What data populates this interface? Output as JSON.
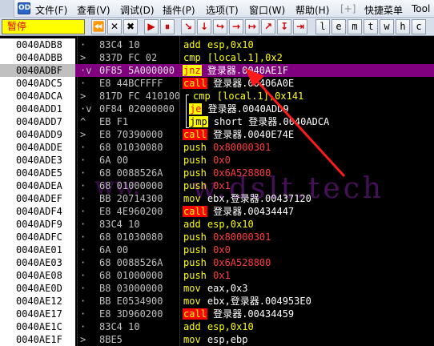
{
  "menu": {
    "items": [
      "文件(F)",
      "查看(V)",
      "调试(D)",
      "插件(P)",
      "选项(T)",
      "窗口(W)",
      "帮助(H)",
      "[+]",
      "快捷菜单",
      "Tool"
    ]
  },
  "toolbar": {
    "status": "暂停",
    "buttons": [
      "⏪",
      "✕",
      "▶",
      "⏸",
      "↘",
      "↓",
      "↪",
      "→",
      "↦"
    ],
    "letters": [
      "l",
      "e",
      "m",
      "t",
      "w",
      "h",
      "c"
    ]
  },
  "watermark": {
    "text": "w.dslt.tech",
    "left_text": "ww."
  },
  "rows": [
    {
      "addr": "0040ADB8",
      "mark": "·",
      "hex": "83C4 10",
      "mnem": "add",
      "kind": "add",
      "ops": "esp,0x10",
      "opcls": "op"
    },
    {
      "addr": "0040ADBB",
      "mark": ">",
      "hex": "837D FC 02",
      "mnem": "cmp",
      "kind": "cmp",
      "ops": "[local.1],0x2",
      "opcls": "op"
    },
    {
      "addr": "0040ADBF",
      "mark": "·v",
      "hex": "0F85 5A000000",
      "mnem": "jnz",
      "kind": "jcc",
      "ops": "登录器.0040AE1F",
      "opcls": "op-addr",
      "selected": true
    },
    {
      "addr": "0040ADC5",
      "mark": "·",
      "hex": "E8 44BCFFFF",
      "mnem": "call",
      "kind": "call",
      "ops": "登录器.00406A0E",
      "opcls": "op-addr"
    },
    {
      "addr": "0040ADCA",
      "mark": ">",
      "hex": "817D FC 41010000",
      "mnem": "cmp",
      "kind": "cmp",
      "ops": "[local.1],0x141",
      "opcls": "op"
    },
    {
      "addr": "0040ADD1",
      "mark": "·v",
      "hex": "0F84 02000000",
      "mnem": "je",
      "kind": "jcc",
      "ops": "登录器.0040ADD9",
      "opcls": "op-addr"
    },
    {
      "addr": "0040ADD7",
      "mark": "^",
      "hex": "EB F1",
      "mnem": "jmp",
      "kind": "jmp",
      "ops": "short 登录器.0040ADCA",
      "opcls": "op-addr"
    },
    {
      "addr": "0040ADD9",
      "mark": ">",
      "hex": "E8 70390000",
      "mnem": "call",
      "kind": "call",
      "ops": "登录器.0040E74E",
      "opcls": "op-addr"
    },
    {
      "addr": "0040ADDE",
      "mark": "·",
      "hex": "68 01030080",
      "mnem": "push",
      "kind": "push",
      "ops": "0x80000301",
      "opcls": "op-push"
    },
    {
      "addr": "0040ADE3",
      "mark": "·",
      "hex": "6A 00",
      "mnem": "push",
      "kind": "push",
      "ops": "0x0",
      "opcls": "op-push"
    },
    {
      "addr": "0040ADE5",
      "mark": "·",
      "hex": "68 0088526A",
      "mnem": "push",
      "kind": "push",
      "ops": "0x6A528800",
      "opcls": "op-push"
    },
    {
      "addr": "0040ADEA",
      "mark": "·",
      "hex": "68 01000000",
      "mnem": "push",
      "kind": "push",
      "ops": "0x1",
      "opcls": "op-push"
    },
    {
      "addr": "0040ADEF",
      "mark": "·",
      "hex": "BB 20714300",
      "mnem": "mov",
      "kind": "mov",
      "ops": "ebx,登录器.00437120",
      "opcls": "op-plain"
    },
    {
      "addr": "0040ADF4",
      "mark": "·",
      "hex": "E8 4E960200",
      "mnem": "call",
      "kind": "call",
      "ops": "登录器.00434447",
      "opcls": "op-addr"
    },
    {
      "addr": "0040ADF9",
      "mark": "·",
      "hex": "83C4 10",
      "mnem": "add",
      "kind": "add",
      "ops": "esp,0x10",
      "opcls": "op"
    },
    {
      "addr": "0040ADFC",
      "mark": "·",
      "hex": "68 01030080",
      "mnem": "push",
      "kind": "push",
      "ops": "0x80000301",
      "opcls": "op-push"
    },
    {
      "addr": "0040AE01",
      "mark": "·",
      "hex": "6A 00",
      "mnem": "push",
      "kind": "push",
      "ops": "0x0",
      "opcls": "op-push"
    },
    {
      "addr": "0040AE03",
      "mark": "·",
      "hex": "68 0088526A",
      "mnem": "push",
      "kind": "push",
      "ops": "0x6A528800",
      "opcls": "op-push"
    },
    {
      "addr": "0040AE08",
      "mark": "·",
      "hex": "68 01000000",
      "mnem": "push",
      "kind": "push",
      "ops": "0x1",
      "opcls": "op-push"
    },
    {
      "addr": "0040AE0D",
      "mark": "·",
      "hex": "B8 03000000",
      "mnem": "mov",
      "kind": "mov",
      "ops": "eax,0x3",
      "opcls": "op-plain"
    },
    {
      "addr": "0040AE12",
      "mark": "·",
      "hex": "BB E0534900",
      "mnem": "mov",
      "kind": "mov",
      "ops": "ebx,登录器.004953E0",
      "opcls": "op-plain"
    },
    {
      "addr": "0040AE17",
      "mark": "·",
      "hex": "E8 3D960200",
      "mnem": "call",
      "kind": "call",
      "ops": "登录器.00434459",
      "opcls": "op-addr"
    },
    {
      "addr": "0040AE1C",
      "mark": "·",
      "hex": "83C4 10",
      "mnem": "add",
      "kind": "add",
      "ops": "esp,0x10",
      "opcls": "op"
    },
    {
      "addr": "0040AE1F",
      "mark": ">",
      "hex": "8BE5",
      "mnem": "mov",
      "kind": "mov",
      "ops": "esp,ebp",
      "opcls": "op-plain"
    }
  ]
}
